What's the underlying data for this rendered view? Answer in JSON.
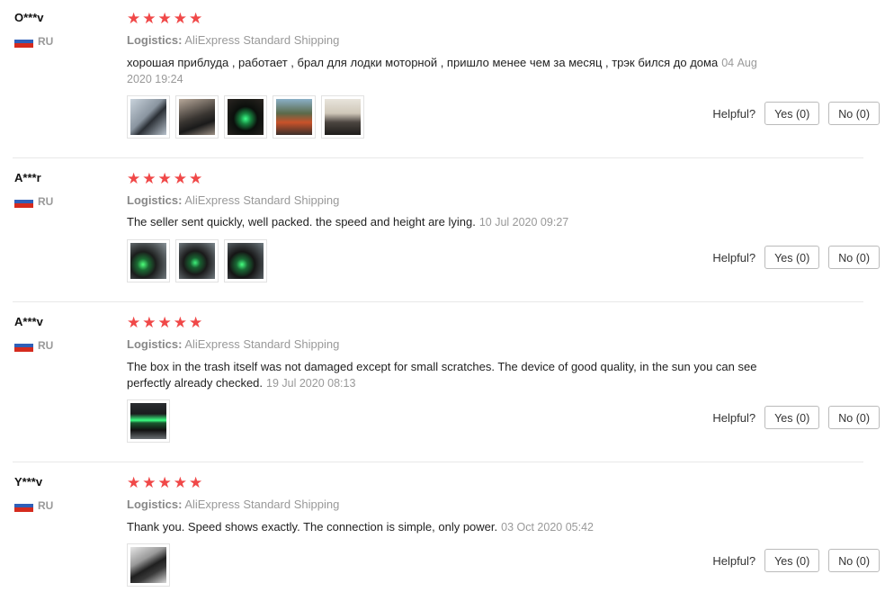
{
  "helpful_label": "Helpful?",
  "star_glyph": "★",
  "star_color": "#f04848",
  "reviews": [
    {
      "user": "O***v",
      "country": "RU",
      "stars": 5,
      "logistics_label": "Logistics:",
      "logistics_value": "AliExpress Standard Shipping",
      "text": "хорошая приблуда , работает , брал для лодки моторной , пришло менее чем за месяц , трэк бился до дома",
      "date": "04 Aug 2020 19:24",
      "yes_label": "Yes (0)",
      "no_label": "No (0)",
      "images": 5
    },
    {
      "user": "A***r",
      "country": "RU",
      "stars": 5,
      "logistics_label": "Logistics:",
      "logistics_value": "AliExpress Standard Shipping",
      "text": "The seller sent quickly, well packed. the speed and height are lying.",
      "date": "10 Jul 2020 09:27",
      "yes_label": "Yes (0)",
      "no_label": "No (0)",
      "images": 3
    },
    {
      "user": "A***v",
      "country": "RU",
      "stars": 5,
      "logistics_label": "Logistics:",
      "logistics_value": "AliExpress Standard Shipping",
      "text": "The box in the trash itself was not damaged except for small scratches. The device of good quality, in the sun you can see perfectly already checked.",
      "date": "19 Jul 2020 08:13",
      "yes_label": "Yes (0)",
      "no_label": "No (0)",
      "images": 1
    },
    {
      "user": "Y***v",
      "country": "RU",
      "stars": 5,
      "logistics_label": "Logistics:",
      "logistics_value": "AliExpress Standard Shipping",
      "text": "Thank you. Speed shows exactly. The connection is simple, only power.",
      "date": "03 Oct 2020 05:42",
      "yes_label": "Yes (0)",
      "no_label": "No (0)",
      "images": 1
    }
  ]
}
